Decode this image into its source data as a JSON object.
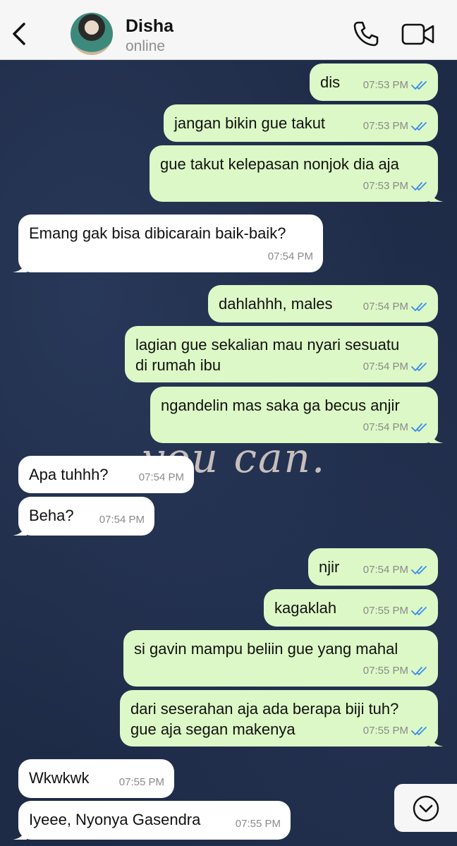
{
  "header": {
    "contact_name": "Disha",
    "status": "online",
    "icons": [
      "back-chevron-icon",
      "avatar",
      "phone-icon",
      "video-camera-icon"
    ]
  },
  "wallpaper": {
    "text": "you can."
  },
  "colors": {
    "outgoing_bubble": "#dcf8c6",
    "incoming_bubble": "#ffffff",
    "read_tick": "#3b8cf0"
  },
  "messages": [
    {
      "dir": "out",
      "text": "dis",
      "time": "07:53 PM",
      "read": true
    },
    {
      "dir": "out",
      "text": "jangan bikin gue takut",
      "time": "07:53 PM",
      "read": true
    },
    {
      "dir": "out",
      "text": "gue takut kelepasan nonjok dia aja",
      "time": "07:53 PM",
      "read": true
    },
    {
      "dir": "in",
      "text": "Emang gak bisa dibicarain baik-baik?",
      "time": "07:54 PM"
    },
    {
      "dir": "out",
      "text": "dahlahhh, males",
      "time": "07:54 PM",
      "read": true
    },
    {
      "dir": "out",
      "text": "lagian gue sekalian mau nyari sesuatu\ndi rumah ibu",
      "time": "07:54 PM",
      "read": true
    },
    {
      "dir": "out",
      "text": "ngandelin mas saka ga becus anjir",
      "time": "07:54 PM",
      "read": true
    },
    {
      "dir": "in",
      "text": "Apa tuhhh?",
      "time": "07:54 PM"
    },
    {
      "dir": "in",
      "text": "Beha?",
      "time": "07:54 PM"
    },
    {
      "dir": "out",
      "text": "njir",
      "time": "07:54 PM",
      "read": true
    },
    {
      "dir": "out",
      "text": "kagaklah",
      "time": "07:55 PM",
      "read": true
    },
    {
      "dir": "out",
      "text": "si gavin mampu beliin gue yang mahal",
      "time": "07:55 PM",
      "read": true
    },
    {
      "dir": "out",
      "text": "dari seserahan aja ada berapa biji tuh?\ngue aja segan makenya",
      "time": "07:55 PM",
      "read": true
    },
    {
      "dir": "in",
      "text": "Wkwkwk",
      "time": "07:55 PM"
    },
    {
      "dir": "in",
      "text": "Iyeee, Nyonya Gasendra",
      "time": "07:55 PM"
    }
  ]
}
